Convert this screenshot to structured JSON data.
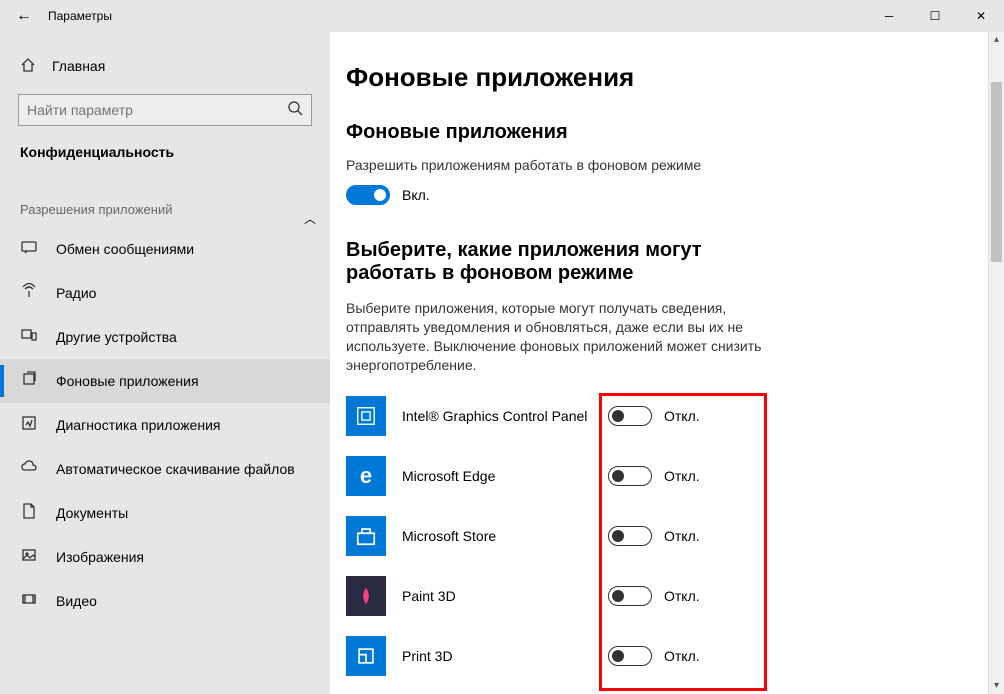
{
  "window": {
    "title": "Параметры"
  },
  "sidebar": {
    "home": "Главная",
    "search_placeholder": "Найти параметр",
    "category": "Конфиденциальность",
    "section": "Разрешения приложений",
    "items": [
      {
        "label": "Обмен сообщениями",
        "active": false
      },
      {
        "label": "Радио",
        "active": false
      },
      {
        "label": "Другие устройства",
        "active": false
      },
      {
        "label": "Фоновые приложения",
        "active": true
      },
      {
        "label": "Диагностика приложения",
        "active": false
      },
      {
        "label": "Автоматическое скачивание файлов",
        "active": false
      },
      {
        "label": "Документы",
        "active": false
      },
      {
        "label": "Изображения",
        "active": false
      },
      {
        "label": "Видео",
        "active": false
      }
    ]
  },
  "main": {
    "title": "Фоновые приложения",
    "subtitle": "Фоновые приложения",
    "allow_text": "Разрешить приложениям работать в фоновом режиме",
    "master_toggle_label": "Вкл.",
    "choose_title": "Выберите, какие приложения могут работать в фоновом режиме",
    "choose_desc": "Выберите приложения, которые могут получать сведения, отправлять уведомления и обновляться, даже если вы их не используете. Выключение фоновых приложений может снизить энергопотребление.",
    "off_label": "Откл.",
    "apps": [
      {
        "name": "Intel® Graphics Control Panel"
      },
      {
        "name": "Microsoft Edge"
      },
      {
        "name": "Microsoft Store"
      },
      {
        "name": "Paint 3D"
      },
      {
        "name": "Print 3D"
      }
    ]
  }
}
